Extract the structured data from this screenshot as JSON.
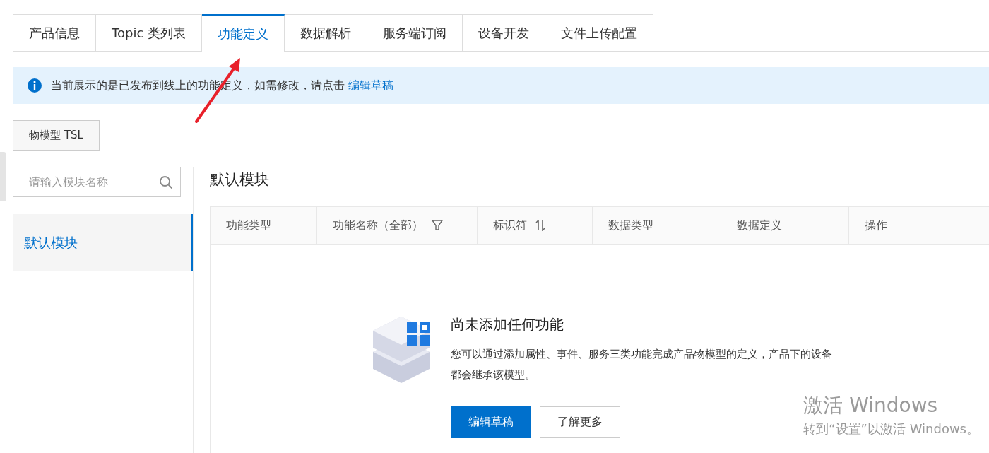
{
  "tabs": [
    {
      "label": "产品信息",
      "selected": false
    },
    {
      "label": "Topic 类列表",
      "selected": false
    },
    {
      "label": "功能定义",
      "selected": true
    },
    {
      "label": "数据解析",
      "selected": false
    },
    {
      "label": "服务端订阅",
      "selected": false
    },
    {
      "label": "设备开发",
      "selected": false
    },
    {
      "label": "文件上传配置",
      "selected": false
    }
  ],
  "notice": {
    "text": "当前展示的是已发布到线上的功能定义，如需修改，请点击",
    "link": "编辑草稿"
  },
  "tsl_button": "物模型 TSL",
  "module_search": {
    "placeholder": "请输入模块名称"
  },
  "modules": [
    {
      "label": "默认模块",
      "selected": true
    }
  ],
  "module_title": "默认模块",
  "table": {
    "columns": [
      {
        "label": "功能类型",
        "kind": "plain"
      },
      {
        "label": "功能名称（全部）",
        "kind": "filter"
      },
      {
        "label": "标识符",
        "kind": "sort"
      },
      {
        "label": "数据类型",
        "kind": "plain"
      },
      {
        "label": "数据定义",
        "kind": "plain"
      },
      {
        "label": "操作",
        "kind": "plain"
      }
    ]
  },
  "empty_state": {
    "title": "尚未添加任何功能",
    "description": "您可以通过添加属性、事件、服务三类功能完成产品物模型的定义，产品下的设备都会继承该模型。",
    "primary_button": "编辑草稿",
    "secondary_button": "了解更多"
  },
  "activation_notice": {
    "title": "激活 Windows",
    "subtitle": "转到“设置”以激活 Windows。"
  }
}
